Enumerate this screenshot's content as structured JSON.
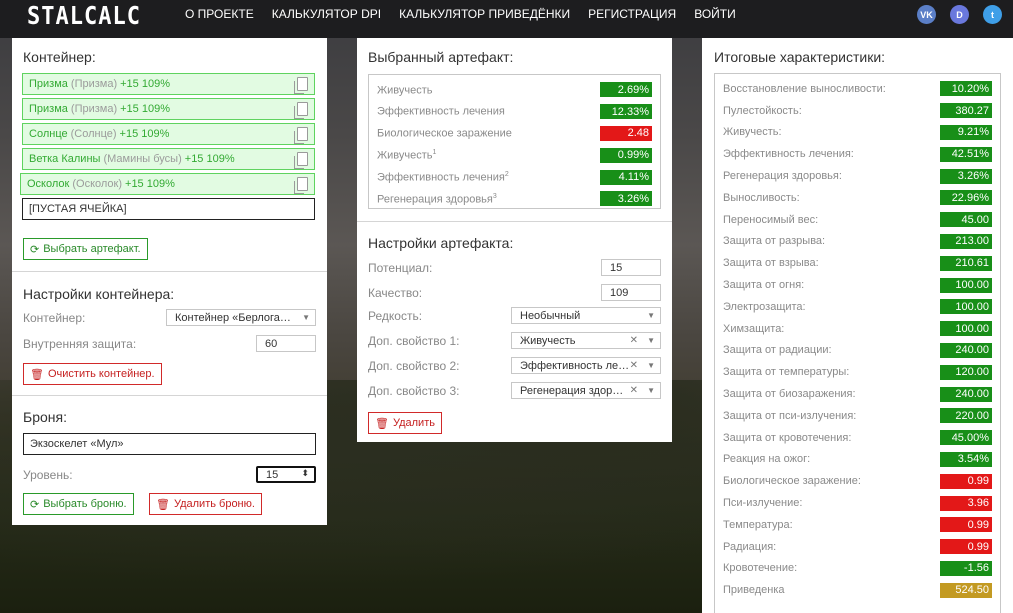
{
  "nav": {
    "logo": "STALCALC",
    "menu": [
      "О ПРОЕКТЕ",
      "КАЛЬКУЛЯТОР DPI",
      "КАЛЬКУЛЯТОР ПРИВЕДЁНКИ",
      "РЕГИСТРАЦИЯ",
      "ВОЙТИ"
    ],
    "social": [
      {
        "icon": "vk-icon",
        "text": "VK",
        "color": "#4a76a8"
      },
      {
        "icon": "discord-icon",
        "text": "D",
        "color": "#5865f2"
      },
      {
        "icon": "twitter-icon",
        "text": "t",
        "color": "#1da1f2"
      }
    ]
  },
  "container": {
    "title": "Контейнер:",
    "artifacts": [
      {
        "name": "Призма",
        "alt": "(Призма)",
        "bonus": "+15 109%"
      },
      {
        "name": "Призма",
        "alt": "(Призма)",
        "bonus": "+15 109%"
      },
      {
        "name": "Солнце",
        "alt": "(Солнце)",
        "bonus": "+15 109%"
      },
      {
        "name": "Ветка Калины",
        "alt": "(Мамины бусы)",
        "bonus": "+15 109%"
      },
      {
        "name": "Осколок",
        "alt": "(Осколок)",
        "bonus": "+15 109%"
      }
    ],
    "empty_slot": "[ПУСТАЯ ЯЧЕЙКА]",
    "select_button": "Выбрать артефакт."
  },
  "container_settings": {
    "title": "Настройки контейнера:",
    "container_label": "Контейнер:",
    "container_value": "Контейнер «Берлога…",
    "protection_label": "Внутренняя защита:",
    "protection_value": "60",
    "clear_button": "Очистить контейнер."
  },
  "armor": {
    "title": "Броня:",
    "name": "Экзоскелет «Мул»",
    "level_label": "Уровень:",
    "level_value": "15",
    "select_button": "Выбрать броню.",
    "delete_button": "Удалить броню."
  },
  "selected": {
    "title": "Выбранный артефакт:",
    "stats": [
      {
        "name": "Живучесть",
        "sup": "",
        "value": "2.69%",
        "color": "g"
      },
      {
        "name": "Эффективность лечения",
        "sup": "",
        "value": "12.33%",
        "color": "g"
      },
      {
        "name": "Биологическое заражение",
        "sup": "",
        "value": "2.48",
        "color": "r"
      },
      {
        "name": "Живучесть",
        "sup": "1",
        "value": "0.99%",
        "color": "g"
      },
      {
        "name": "Эффективность лечения",
        "sup": "2",
        "value": "4.11%",
        "color": "g"
      },
      {
        "name": "Регенерация здоровья",
        "sup": "3",
        "value": "3.26%",
        "color": "g"
      }
    ]
  },
  "art_settings": {
    "title": "Настройки артефакта:",
    "potential_label": "Потенциал:",
    "potential_value": "15",
    "quality_label": "Качество:",
    "quality_value": "109",
    "rarity_label": "Редкость:",
    "rarity_value": "Необычный",
    "prop1_label": "Доп. свойство 1:",
    "prop1_value": "Живучесть",
    "prop2_label": "Доп. свойство 2:",
    "prop2_value": "Эффективность ле…",
    "prop3_label": "Доп. свойство 3:",
    "prop3_value": "Регенерация здор…",
    "delete_button": "Удалить"
  },
  "totals": {
    "title": "Итоговые характеристики:",
    "stats": [
      {
        "name": "Восстановление выносливости:",
        "value": "10.20%",
        "color": "g"
      },
      {
        "name": "Пулестойкость:",
        "value": "380.27",
        "color": "g"
      },
      {
        "name": "Живучесть:",
        "value": "9.21%",
        "color": "g"
      },
      {
        "name": "Эффективность лечения:",
        "value": "42.51%",
        "color": "g"
      },
      {
        "name": "Регенерация здоровья:",
        "value": "3.26%",
        "color": "g"
      },
      {
        "name": "Выносливость:",
        "value": "22.96%",
        "color": "g"
      },
      {
        "name": "Переносимый вес:",
        "value": "45.00",
        "color": "g"
      },
      {
        "name": "Защита от разрыва:",
        "value": "213.00",
        "color": "g"
      },
      {
        "name": "Защита от взрыва:",
        "value": "210.61",
        "color": "g"
      },
      {
        "name": "Защита от огня:",
        "value": "100.00",
        "color": "g"
      },
      {
        "name": "Электрозащита:",
        "value": "100.00",
        "color": "g"
      },
      {
        "name": "Химзащита:",
        "value": "100.00",
        "color": "g"
      },
      {
        "name": "Защита от радиации:",
        "value": "240.00",
        "color": "g"
      },
      {
        "name": "Защита от температуры:",
        "value": "120.00",
        "color": "g"
      },
      {
        "name": "Защита от биозаражения:",
        "value": "240.00",
        "color": "g"
      },
      {
        "name": "Защита от пси-излучения:",
        "value": "220.00",
        "color": "g"
      },
      {
        "name": "Защита от кровотечения:",
        "value": "45.00%",
        "color": "g"
      },
      {
        "name": "Реакция на ожог:",
        "value": "3.54%",
        "color": "g"
      },
      {
        "name": "Биологическое заражение:",
        "value": "0.99",
        "color": "r"
      },
      {
        "name": "Пси-излучение:",
        "value": "3.96",
        "color": "r"
      },
      {
        "name": "Температура:",
        "value": "0.99",
        "color": "r"
      },
      {
        "name": "Радиация:",
        "value": "0.99",
        "color": "r"
      },
      {
        "name": "Кровотечение:",
        "value": "-1.56",
        "color": "g"
      },
      {
        "name": "Приведенка",
        "value": "524.50",
        "color": "y"
      }
    ]
  }
}
